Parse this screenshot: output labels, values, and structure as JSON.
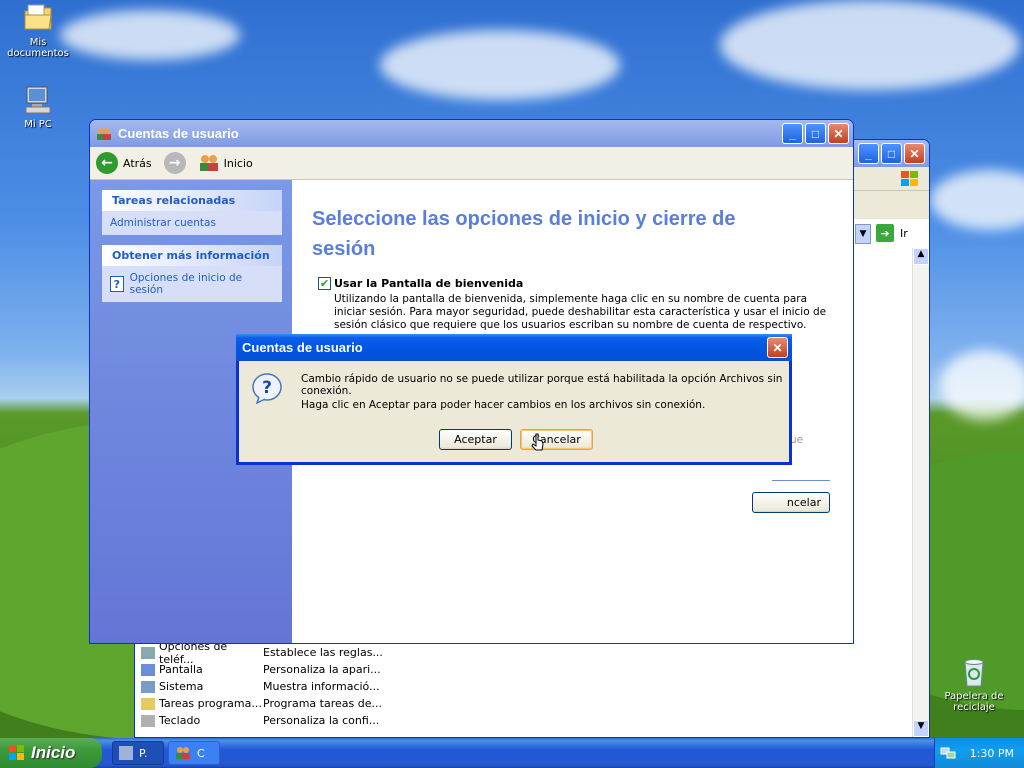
{
  "desktop": {
    "icons": [
      {
        "label": "Mis documentos"
      },
      {
        "label": "Mi PC"
      },
      {
        "label": "Papelera de reciclaje"
      }
    ]
  },
  "back_window": {
    "go_label": "Ir",
    "rows": [
      {
        "name": "Opciones de teléf...",
        "desc": "Establece las reglas..."
      },
      {
        "name": "Pantalla",
        "desc": "Personaliza la apari..."
      },
      {
        "name": "Sistema",
        "desc": "Muestra informació..."
      },
      {
        "name": "Tareas programa...",
        "desc": "Programa tareas de..."
      },
      {
        "name": "Teclado",
        "desc": "Personaliza la confi..."
      }
    ]
  },
  "main_window": {
    "title": "Cuentas de usuario",
    "toolbar": {
      "back_label": "Atrás",
      "home_label": "Inicio"
    },
    "sidebar": {
      "related_header": "Tareas relacionadas",
      "related_link": "Administrar cuentas",
      "info_header": "Obtener más información",
      "info_link": "Opciones de inicio de sesión"
    },
    "heading": "Seleccione las opciones de inicio y cierre de sesión",
    "welcome_option": {
      "label": "Usar la Pantalla de bienvenida",
      "description": "Utilizando la pantalla de bienvenida, simplemente haga clic en su nombre de cuenta para iniciar sesión. Para mayor seguridad, puede deshabilitar esta característica y usar el inicio de sesión clásico que requiere que los usuarios escriban su nombre de cuenta de respectivo."
    },
    "partial_text": "ue",
    "cancel_partial": "ncelar"
  },
  "dialog": {
    "title": "Cuentas de usuario",
    "message1": "Cambio rápido de usuario no se puede utilizar porque está habilitada la opción Archivos sin conexión.",
    "message2": "Haga clic en Aceptar para poder hacer cambios en los archivos sin conexión.",
    "ok_label": "Aceptar",
    "cancel_label": "Cancelar"
  },
  "taskbar": {
    "start_label": "Inicio",
    "tasks": [
      {
        "label": "P."
      },
      {
        "label": "C"
      }
    ],
    "clock": "1:30 PM"
  }
}
